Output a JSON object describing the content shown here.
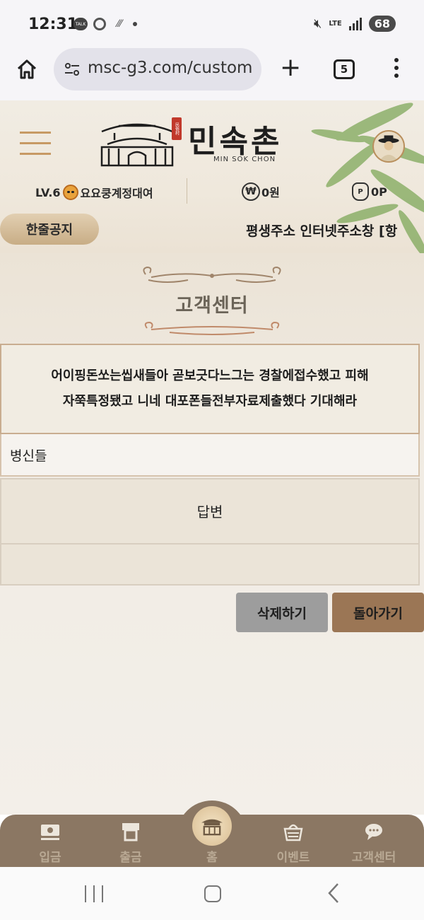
{
  "status_bar": {
    "time": "12:31",
    "network": "LTE",
    "battery": "68",
    "notification_icons": [
      "talk-icon",
      "chrome-icon",
      "slash-icon",
      "dot-icon"
    ]
  },
  "browser": {
    "url": "msc-g3.com/custom",
    "tab_count": "5"
  },
  "site": {
    "logo_text": "민속촌",
    "logo_sub": "MIN SOK CHON",
    "seal_text": "民俗村",
    "level": "LV.6",
    "username": "요요쿵계정대여",
    "money": "0원",
    "points": "0P",
    "notice_label": "한줄공지",
    "notice_text": "평생주소 인터넷주소창 [항"
  },
  "page": {
    "title": "고객센터",
    "question_lines": [
      "어이핑돈쏘는씹새들아 곧보긋다느그는 경찰에접수했고 피해",
      "자쭉특정됐고 니네 대포폰들전부자료제출했다 기대해라"
    ],
    "subject": "병신들",
    "answer_label": "답변",
    "answer_body": "",
    "delete_button": "삭제하기",
    "back_button": "돌아가기"
  },
  "bottom_nav": [
    {
      "label": "입금",
      "icon": "deposit-icon"
    },
    {
      "label": "출금",
      "icon": "withdraw-icon"
    },
    {
      "label": "홈",
      "icon": "home-palace-icon"
    },
    {
      "label": "이벤트",
      "icon": "event-basket-icon"
    },
    {
      "label": "고객센터",
      "icon": "chat-support-icon"
    }
  ],
  "colors": {
    "accent_brown": "#9b7655",
    "nav_bg": "#8b7763",
    "gray_button": "#9d9d9d",
    "border_tan": "#c9ad90"
  }
}
